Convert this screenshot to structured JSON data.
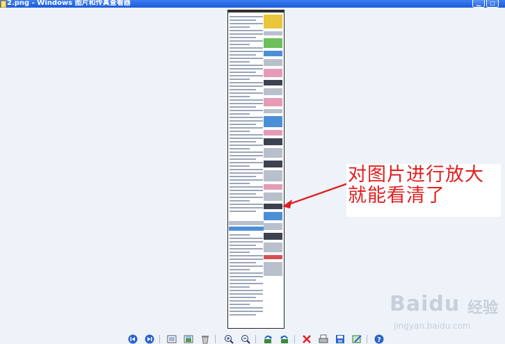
{
  "window": {
    "title": "2.png - Windows 图片和传真查看器",
    "minimize_icon": "minimize-icon",
    "maximize_icon": "maximize-icon"
  },
  "callout": {
    "line1": "对图片进行放大",
    "line2": "就能看清了",
    "color": "#e02020"
  },
  "watermark": {
    "logo": "Baidu",
    "logo_suffix": "经验",
    "url": "jingyan.baidu.com"
  },
  "toolbar": {
    "buttons": [
      {
        "name": "previous-image-button",
        "icon": "prev-icon"
      },
      {
        "name": "next-image-button",
        "icon": "next-icon"
      },
      {
        "name": "best-fit-button",
        "icon": "best-fit-icon"
      },
      {
        "name": "actual-size-button",
        "icon": "actual-size-icon"
      },
      {
        "name": "slideshow-button",
        "icon": "slideshow-icon"
      },
      {
        "name": "zoom-in-button",
        "icon": "zoom-in-icon"
      },
      {
        "name": "zoom-out-button",
        "icon": "zoom-out-icon"
      },
      {
        "name": "rotate-clockwise-button",
        "icon": "rotate-cw-icon"
      },
      {
        "name": "rotate-counterclockwise-button",
        "icon": "rotate-ccw-icon"
      },
      {
        "name": "delete-button",
        "icon": "delete-icon"
      },
      {
        "name": "print-button",
        "icon": "print-icon"
      },
      {
        "name": "save-button",
        "icon": "save-icon"
      },
      {
        "name": "edit-button",
        "icon": "edit-icon"
      },
      {
        "name": "help-button",
        "icon": "help-icon"
      }
    ]
  }
}
